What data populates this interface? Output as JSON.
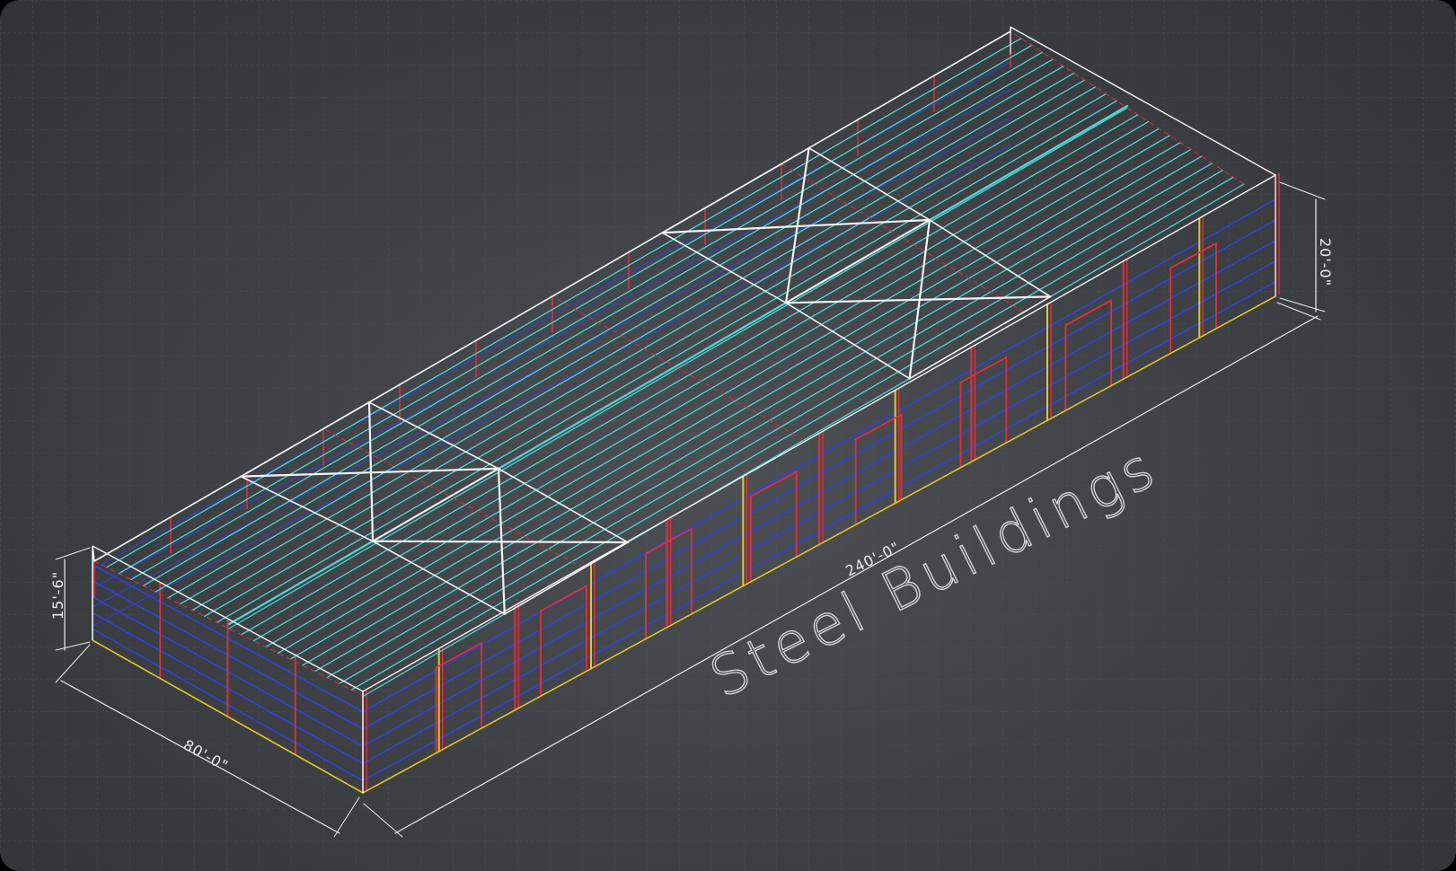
{
  "title": "Steel Buildings",
  "dimensions": {
    "length": "240'-0\"",
    "width": "80'-0\"",
    "eave_height_front": "15'-6\"",
    "eave_height_back": "20'-0\""
  },
  "colors": {
    "background": "#414448",
    "grid": "#575a5e",
    "roof_purlins": "#4fd6d6",
    "girts": "#2f43d8",
    "frames": "#e0303a",
    "bracing": "#f2f4f6",
    "base_line": "#e6c62a",
    "dimension_lines": "#e8ecef"
  }
}
